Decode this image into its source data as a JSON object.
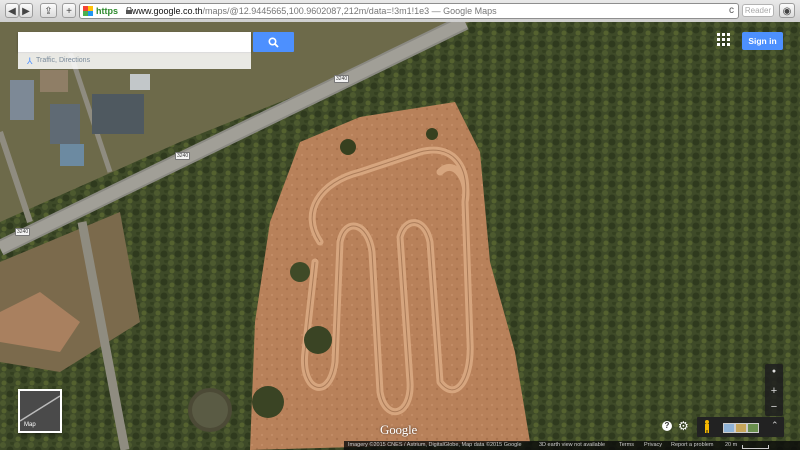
{
  "browser": {
    "url_scheme": "https",
    "url_host": "www.google.co.th",
    "url_rest": "/maps/@12.9445665,100.9602087,212m/data=!3m1!1e3",
    "title_suffix": " — Google Maps",
    "reader_label": "Reader",
    "reload_glyph": "c"
  },
  "search": {
    "placeholder": "",
    "button_glyph": "search-icon",
    "directions_label": "Traffic, Directions"
  },
  "header": {
    "apps_icon": "apps-grid-icon",
    "signin_label": "Sign in",
    "accent": "#4d90fe"
  },
  "map": {
    "road_labels": [
      "3240",
      "3240",
      "3240"
    ],
    "logo": "Google",
    "earth_thumb_label": "Map"
  },
  "controls": {
    "compass_glyph": "●",
    "zoom_in": "+",
    "zoom_out": "−",
    "help_glyph": "?",
    "settings_icon": "gear-icon",
    "street_view_icon": "pegman-icon",
    "expand_glyph": "⌃"
  },
  "footer": {
    "imagery": "Imagery ©2015 CNES / Astrium, DigitalGlobe, Map data ©2015 Google",
    "earth_notice": "3D earth view not available",
    "terms": "Terms",
    "privacy": "Privacy",
    "report": "Report a problem",
    "scale": "20 m"
  }
}
